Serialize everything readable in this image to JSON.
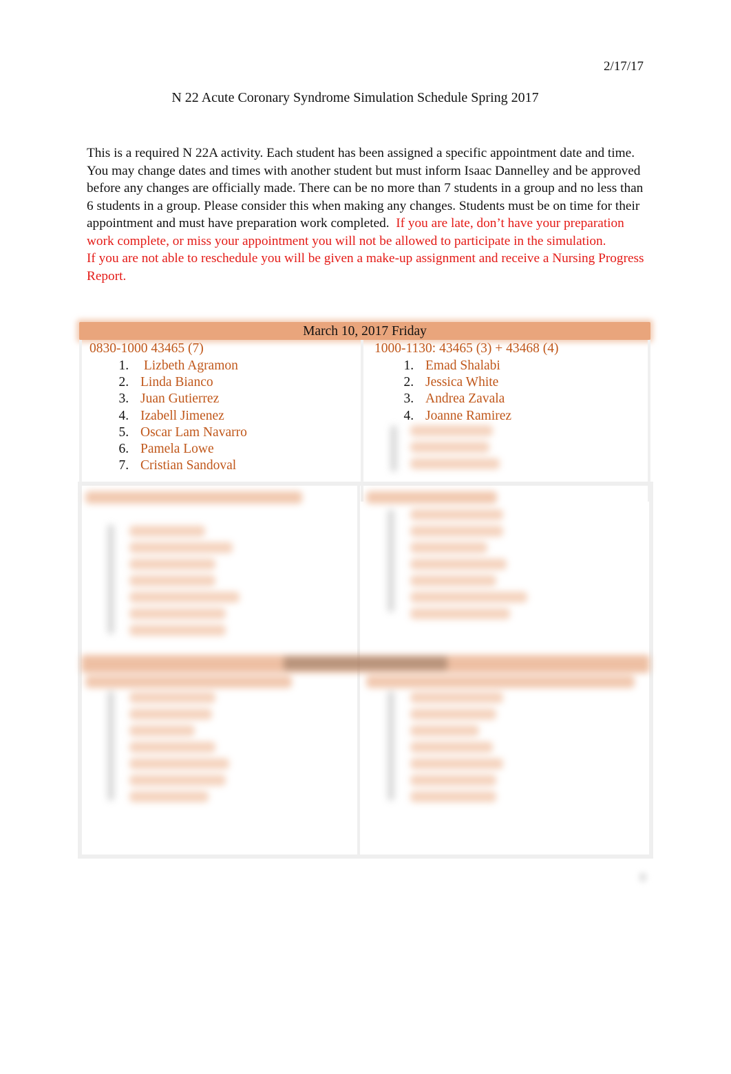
{
  "header": {
    "date": "2/17/17",
    "title": "N 22 Acute Coronary Syndrome Simulation Schedule Spring 2017"
  },
  "intro": {
    "text_black": "This is a required N 22A activity.  Each student has been assigned a specific appointment date and time.  You may change dates and times with another student but must inform Isaac Dannelley and be approved before any changes are officially made.  There can be no more than 7 students in a group and no less than 6 students in a group.  Please consider this when making any changes.  Students must be on time for their appointment and must  have preparation work completed.",
    "text_red_1": "If you are late, don’t have your preparation work complete, or miss your appointment you will not be allowed to participate in the simulation.",
    "text_red_2": "If you are not able to reschedule you will be given a make-up assignment and receive a Nursing Progress Report."
  },
  "schedule": {
    "day1": {
      "header": "March 10, 2017 Friday",
      "slots": [
        {
          "label": "0830-1000 43465 (7)",
          "students": [
            "Lizbeth Agramon",
            "Linda Bianco",
            "Juan Gutierrez",
            "Izabell Jimenez",
            "Oscar Lam Navarro",
            "Pamela Lowe",
            "Cristian Sandoval"
          ]
        },
        {
          "label": "1000-1130:   43465 (3) + 43468 (4)",
          "students": [
            "Emad Shalabi",
            "Jessica White",
            "Andrea Zavala",
            "Joanne Ramirez"
          ]
        }
      ]
    }
  },
  "colors": {
    "header_bar": "#e9a57c",
    "name_text": "#c0571a",
    "warning_text": "#e41b17"
  }
}
